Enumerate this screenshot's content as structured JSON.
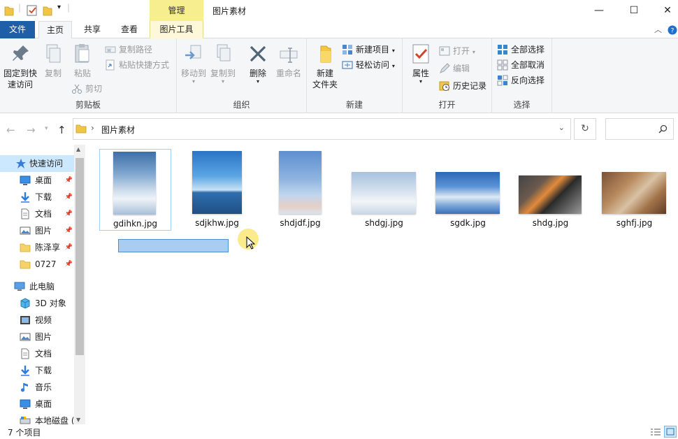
{
  "window": {
    "title": "图片素材",
    "context_tab_header": "管理",
    "controls": {
      "minimize": "—",
      "maximize": "☐",
      "close": "✕"
    }
  },
  "tabs": {
    "file": "文件",
    "home": "主页",
    "share": "共享",
    "view": "查看",
    "picture_tools": "图片工具"
  },
  "ribbon": {
    "clipboard": {
      "label": "剪贴板",
      "pin_line1": "固定到快",
      "pin_line2": "速访问",
      "copy": "复制",
      "paste": "粘贴",
      "copy_path": "复制路径",
      "paste_shortcut": "粘贴快捷方式",
      "cut": "剪切"
    },
    "organize": {
      "label": "组织",
      "move_to": "移动到",
      "copy_to": "复制到",
      "delete": "删除",
      "rename": "重命名"
    },
    "new": {
      "label": "新建",
      "new_folder_line1": "新建",
      "new_folder_line2": "文件夹",
      "new_item": "新建项目",
      "easy_access": "轻松访问"
    },
    "open": {
      "label": "打开",
      "properties": "属性",
      "open": "打开",
      "edit": "编辑",
      "history": "历史记录"
    },
    "select": {
      "label": "选择",
      "select_all": "全部选择",
      "select_none": "全部取消",
      "invert": "反向选择"
    }
  },
  "address": {
    "path": "图片素材",
    "separator": "›"
  },
  "nav": {
    "quick_access": "快速访问",
    "quick_items": [
      {
        "label": "桌面",
        "icon": "desktop-icon"
      },
      {
        "label": "下载",
        "icon": "download-icon"
      },
      {
        "label": "文档",
        "icon": "document-icon"
      },
      {
        "label": "图片",
        "icon": "picture-icon"
      },
      {
        "label": "陈泽享",
        "icon": "folder-icon"
      },
      {
        "label": "0727",
        "icon": "folder-icon"
      }
    ],
    "this_pc": "此电脑",
    "pc_items": [
      {
        "label": "3D 对象",
        "icon": "3d-objects-icon"
      },
      {
        "label": "视频",
        "icon": "video-icon"
      },
      {
        "label": "图片",
        "icon": "picture-icon"
      },
      {
        "label": "文档",
        "icon": "document-icon"
      },
      {
        "label": "下载",
        "icon": "download-icon"
      },
      {
        "label": "音乐",
        "icon": "music-icon"
      },
      {
        "label": "桌面",
        "icon": "desktop-icon"
      },
      {
        "label": "本地磁盘 (",
        "icon": "drive-icon"
      }
    ]
  },
  "files": [
    {
      "name": "gdihkn.jpg"
    },
    {
      "name": "sdjkhw.jpg"
    },
    {
      "name": "shdjdf.jpg"
    },
    {
      "name": "shdgj.jpg"
    },
    {
      "name": "sgdk.jpg"
    },
    {
      "name": "shdg.jpg"
    },
    {
      "name": "sghfj.jpg"
    }
  ],
  "status": {
    "count": "7 个项目"
  }
}
